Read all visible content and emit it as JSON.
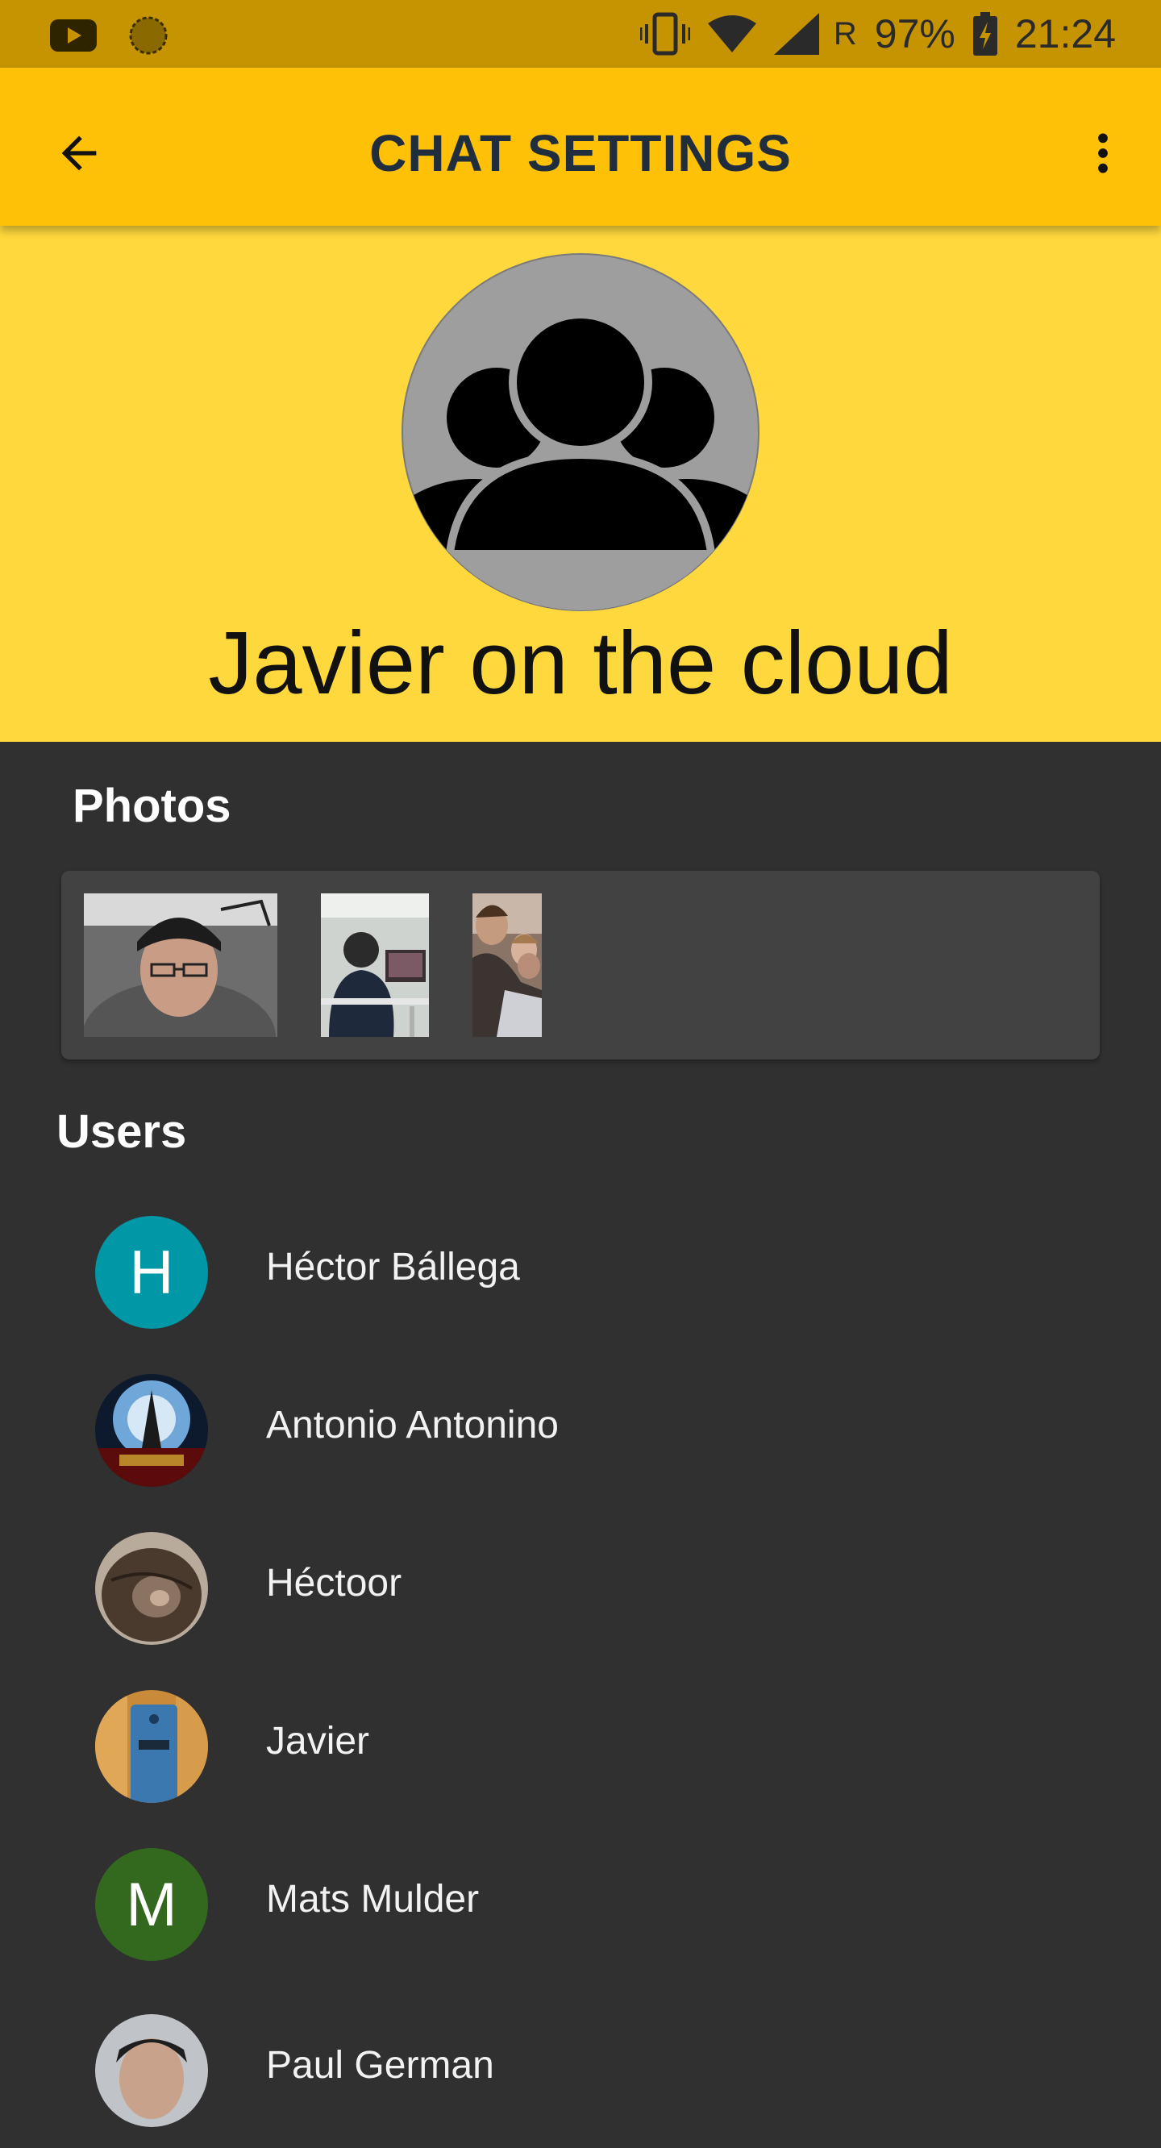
{
  "status_bar": {
    "battery": "97%",
    "time": "21:24",
    "network_letter": "R",
    "icons": [
      "youtube-icon",
      "sync-icon",
      "vibrate-icon",
      "wifi-icon",
      "signal-icon",
      "battery-charging-icon"
    ]
  },
  "app_bar": {
    "title": "CHAT SETTINGS",
    "back_icon": "arrow-back-icon",
    "menu_icon": "more-vert-icon",
    "color": "#FFC107"
  },
  "group": {
    "name": "Javier on the cloud",
    "avatar_icon": "group-icon",
    "header_color": "#FED83C"
  },
  "photos": {
    "title": "Photos",
    "items": [
      "photo-selfie",
      "photo-office",
      "photo-group"
    ]
  },
  "users": {
    "title": "Users",
    "items": [
      {
        "name": "Héctor Bállega",
        "initial": "H",
        "avatar_color": "#0097A7"
      },
      {
        "name": "Antonio Antonino",
        "initial": "",
        "avatar_color": ""
      },
      {
        "name": "Héctoor",
        "initial": "",
        "avatar_color": ""
      },
      {
        "name": "Javier",
        "initial": "",
        "avatar_color": ""
      },
      {
        "name": "Mats Mulder",
        "initial": "M",
        "avatar_color": "#33691E"
      },
      {
        "name": "Paul German",
        "initial": "",
        "avatar_color": ""
      }
    ]
  }
}
